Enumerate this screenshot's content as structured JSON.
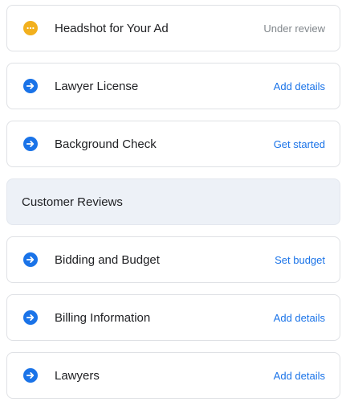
{
  "items": [
    {
      "label": "Headshot for Your Ad",
      "action": "Under review",
      "icon": "pending-dots-icon"
    },
    {
      "label": "Lawyer License",
      "action": "Add details",
      "icon": "arrow-right-circle-icon"
    },
    {
      "label": "Background Check",
      "action": "Get started",
      "icon": "arrow-right-circle-icon"
    },
    {
      "label": "Customer Reviews"
    },
    {
      "label": "Bidding and Budget",
      "action": "Set budget",
      "icon": "arrow-right-circle-icon"
    },
    {
      "label": "Billing Information",
      "action": "Add details",
      "icon": "arrow-right-circle-icon"
    },
    {
      "label": "Lawyers",
      "action": "Add details",
      "icon": "arrow-right-circle-icon"
    }
  ],
  "colors": {
    "accent": "#1a73e8",
    "pending": "#f2b01e",
    "muted_text": "#80868b",
    "section_bg": "#edf1f7",
    "border": "#dfe1e5"
  }
}
